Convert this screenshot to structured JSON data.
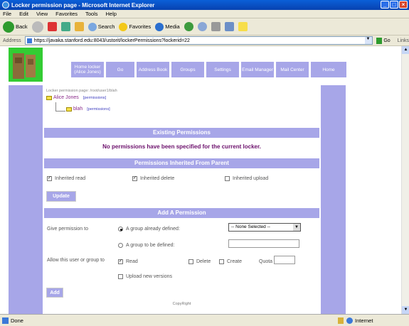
{
  "window": {
    "title": "Locker permission page - Microsoft Internet Explorer"
  },
  "menu": [
    "File",
    "Edit",
    "View",
    "Favorites",
    "Tools",
    "Help"
  ],
  "toolbar": {
    "back": "Back",
    "search": "Search",
    "favorites": "Favorites",
    "media": "Media"
  },
  "address": {
    "label": "Address",
    "url": "https://javaka.stanford.edu:8043/ustorit/lockerPermissions?lockerid=22",
    "go": "Go",
    "links": "Links"
  },
  "nav": [
    "Home locker (Alice Jones)",
    "Go",
    "Address Book",
    "Groups",
    "Settings",
    "Email Manager",
    "Mail Center",
    "Home"
  ],
  "page": {
    "breadcrumb": "Locker permission page: /root/user1/blah",
    "tree_owner": "Alice Jones",
    "tree_child": "blah",
    "perm_link": "[permissions]",
    "existing_header": "Existing Permissions",
    "existing_msg": "No permissions have been specified for the current locker.",
    "inherited_header": "Permissions Inherited From Parent",
    "inh_read": "Inherited read",
    "inh_delete": "Inherited delete",
    "inh_upload": "Inherited upload",
    "update_btn": "Update",
    "add_header": "Add A Permission",
    "give_label": "Give permission to",
    "group_defined": "A group already defined:",
    "group_select": "-- None Selected --",
    "group_to_define": "A group to be defined:",
    "allow_label": "Allow this user or group to",
    "read": "Read",
    "delete": "Delete",
    "create": "Create",
    "quota": "Quota",
    "upload_new": "Upload new versions",
    "add_btn": "Add",
    "copyright": "CopyRight"
  },
  "status": {
    "left": "Done",
    "zone": "Internet"
  }
}
